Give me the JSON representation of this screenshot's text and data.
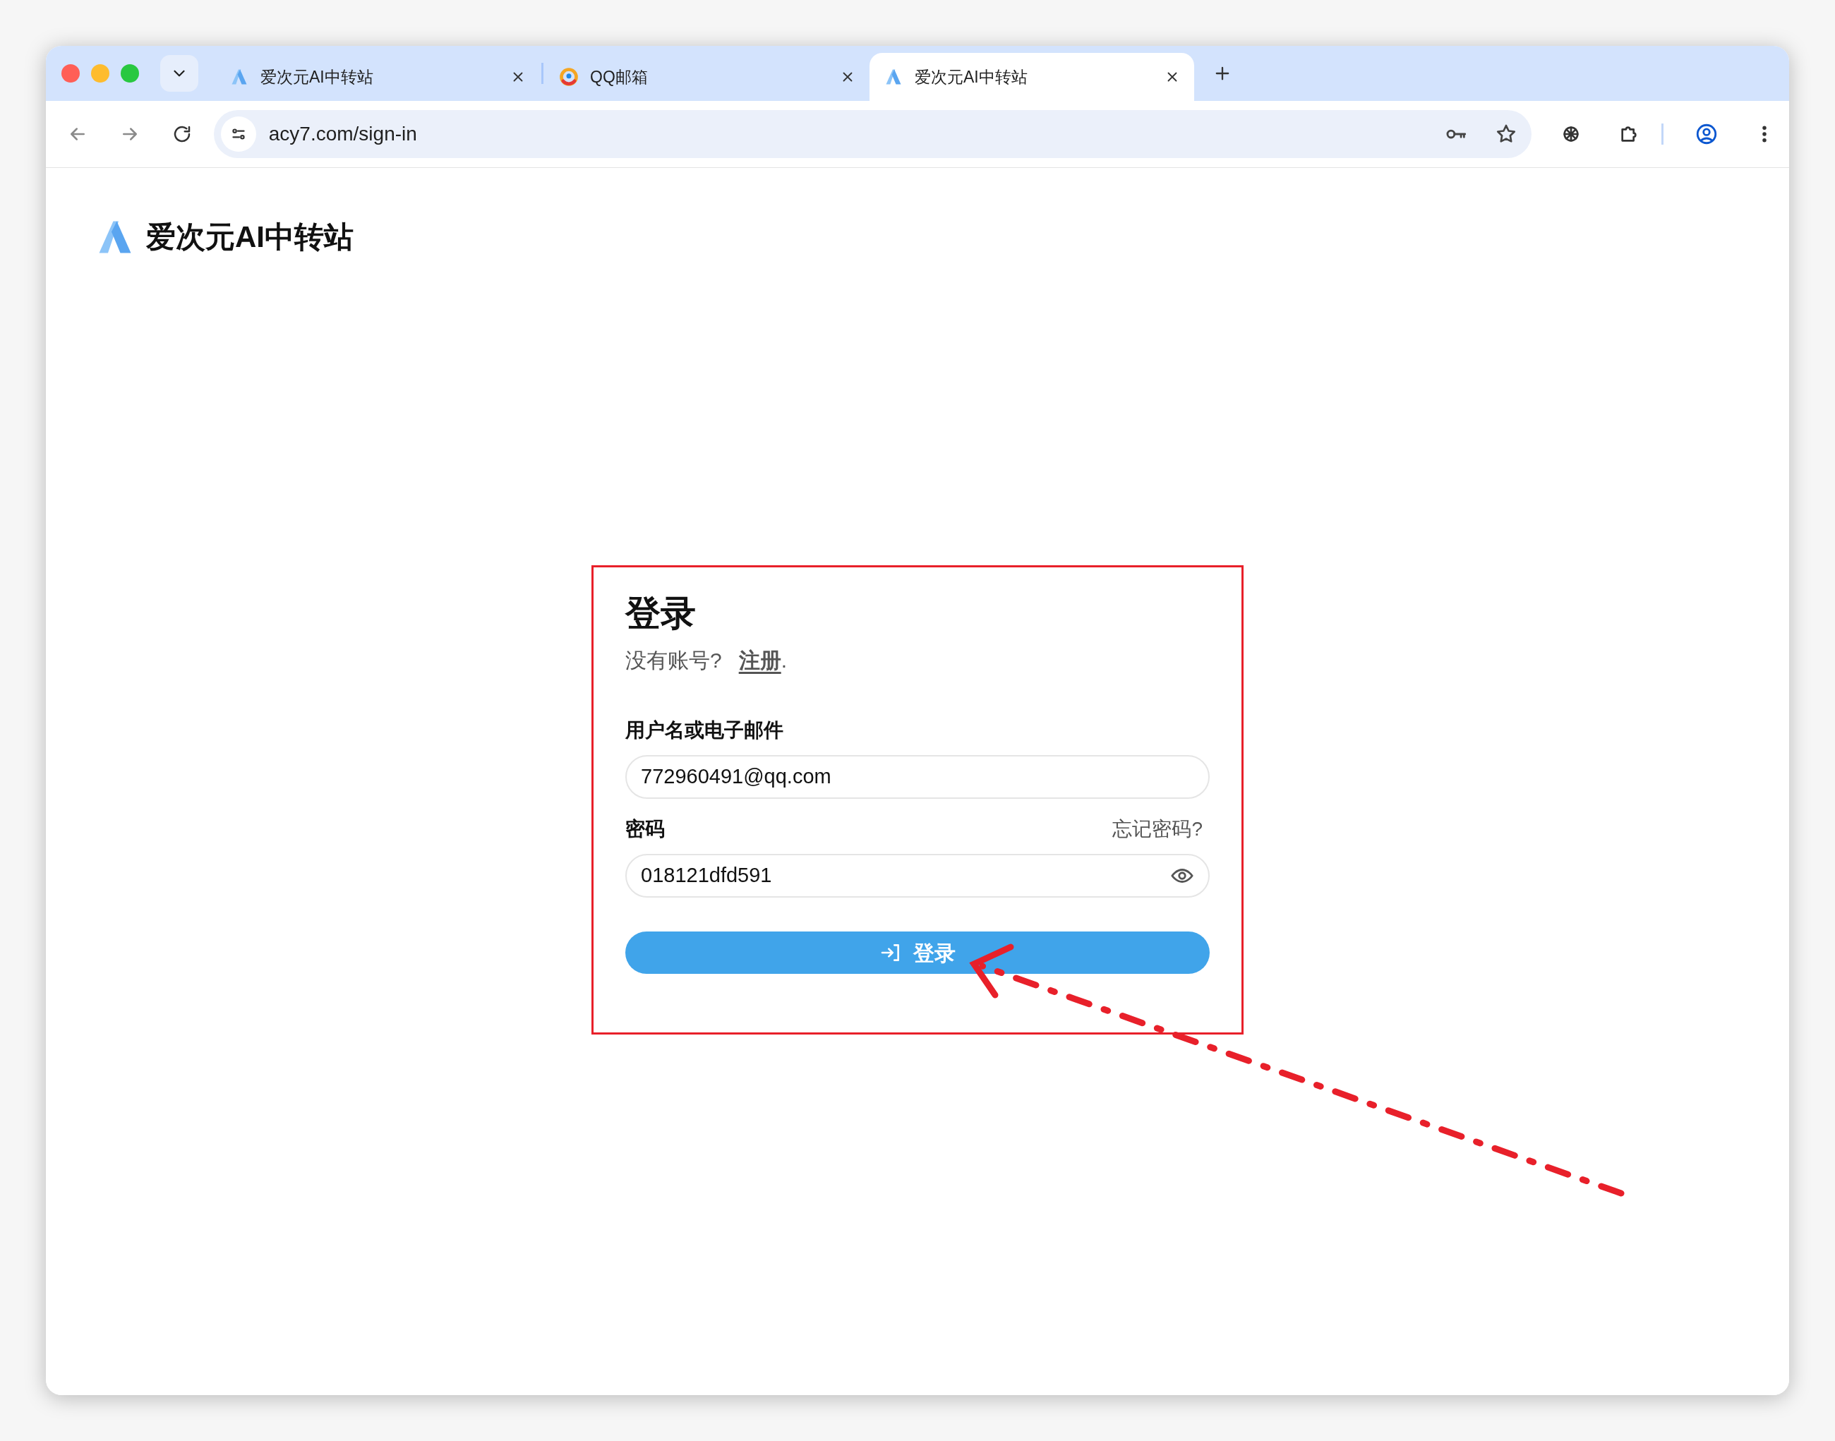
{
  "browser": {
    "tabs": [
      {
        "kind": "site",
        "title": "爱次元AI中转站",
        "selected": false
      },
      {
        "kind": "mail",
        "title": "QQ邮箱",
        "selected": false
      },
      {
        "kind": "site",
        "title": "爱次元AI中转站",
        "selected": true
      }
    ],
    "url": "acy7.com/sign-in"
  },
  "page": {
    "logo_text": "爱次元AI中转站",
    "login": {
      "title": "登录",
      "prompt": "没有账号?",
      "register_link": "注册",
      "register_suffix": ".",
      "fields": [
        {
          "label": "用户名或电子邮件",
          "value": "772960491@qq.com",
          "kind": "text"
        },
        {
          "label": "密码",
          "value": "018121dfd591",
          "kind": "password",
          "aside_link": "忘记密码?"
        }
      ],
      "submit": "登录"
    }
  },
  "annotations": {
    "highlight_box": true,
    "arrow": true
  }
}
